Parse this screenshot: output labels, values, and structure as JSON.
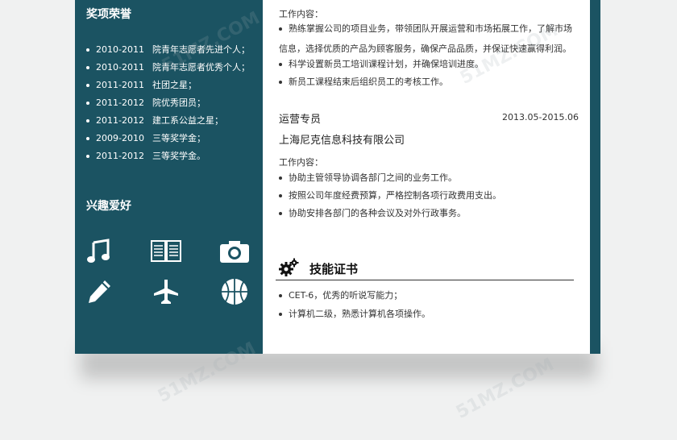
{
  "awards": {
    "title": "奖项荣誉",
    "items": [
      {
        "year": "2010-2011",
        "text": "院青年志愿者先进个人；"
      },
      {
        "year": "2010-2011",
        "text": "院青年志愿者优秀个人；"
      },
      {
        "year": "2011-2011",
        "text": "社团之星；"
      },
      {
        "year": "2011-2012",
        "text": "院优秀团员；"
      },
      {
        "year": "2011-2012",
        "text": "建工系公益之星；"
      },
      {
        "year": "2009-2010",
        "text": "三等奖学金；"
      },
      {
        "year": "2011-2012",
        "text": "三等奖学金。"
      }
    ]
  },
  "hobbies": {
    "title": "兴趣爱好",
    "icons": [
      "music-icon",
      "book-icon",
      "camera-icon",
      "pencil-icon",
      "airplane-icon",
      "basketball-icon"
    ]
  },
  "job1": {
    "content_label": "工作内容：",
    "bullets": [
      "熟练掌握公司的项目业务，带领团队开展运营和市场拓展工作，了解市场",
      "科学设置新员工培训课程计划，并确保培训进度。",
      "新员工课程结束后组织员工的考核工作。"
    ],
    "bullet1_cont": "信息，选择优质的产品为顾客服务，确保产品品质，并保证快速赢得利润。"
  },
  "job2": {
    "title": "运营专员",
    "date": "2013.05-2015.06",
    "company": "上海尼克信息科技有限公司",
    "content_label": "工作内容：",
    "bullets": [
      "协助主管领导协调各部门之间的业务工作。",
      "按照公司年度经费预算，严格控制各项行政费用支出。",
      "协助安排各部门的各种会议及对外行政事务。"
    ]
  },
  "skills": {
    "title": "技能证书",
    "bullets": [
      "CET-6，优秀的听说写能力；",
      "计算机二级，熟悉计算机各项操作。"
    ]
  },
  "watermark": "51MZ.COM",
  "colors": {
    "sidebar": "#1b5362",
    "page_bg": "#f0f1f1"
  }
}
